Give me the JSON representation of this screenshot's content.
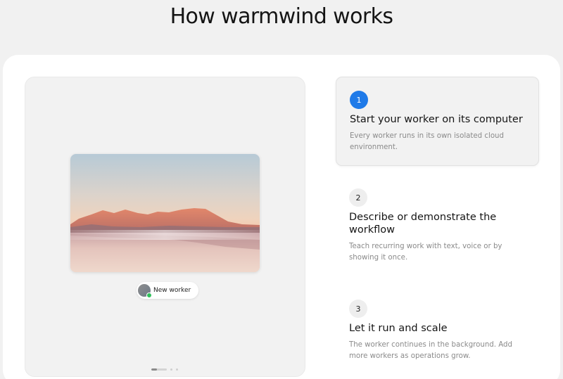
{
  "header": {
    "title": "How warmwind works"
  },
  "media": {
    "worker_chip_label": "New worker",
    "pager": {
      "active_index": 0,
      "total": 3
    }
  },
  "steps": [
    {
      "number": "1",
      "title": "Start your worker on its computer",
      "description": "Every worker runs in its own isolated cloud environment.",
      "active": true
    },
    {
      "number": "2",
      "title": "Describe or demonstrate the workflow",
      "description": "Teach recurring work with text, voice or by showing it once.",
      "active": false
    },
    {
      "number": "3",
      "title": "Let it run and scale",
      "description": "The worker continues in the background. Add more workers as operations grow.",
      "active": false
    }
  ],
  "colors": {
    "accent": "#1f7ae8",
    "status_online": "#2fbf5a"
  },
  "icons": {
    "avatar": "user-avatar-icon",
    "status": "online-status-icon"
  }
}
